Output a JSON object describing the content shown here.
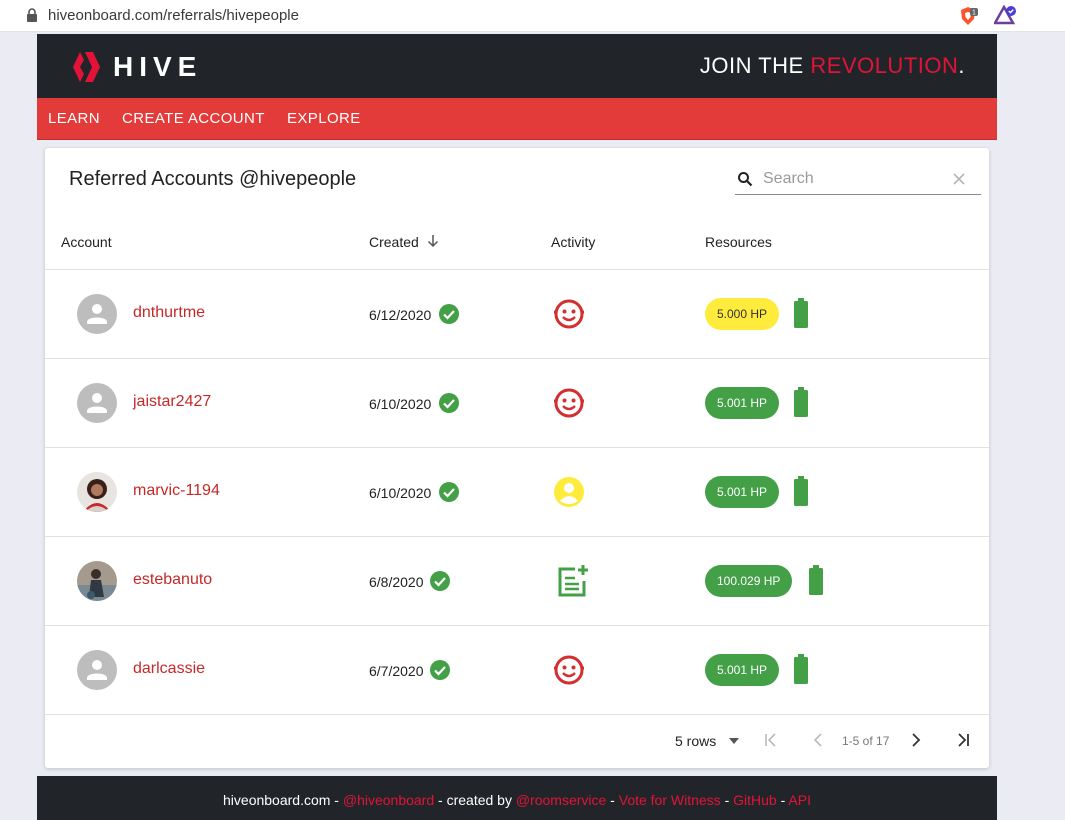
{
  "browser": {
    "url": "hiveonboard.com/referrals/hivepeople",
    "ext_badge": "1"
  },
  "header": {
    "brand": "HIVE",
    "tagline_part1": "JOIN THE ",
    "tagline_part2": "REVOLUTION",
    "tagline_part3": ".",
    "accent_color": "#e31337"
  },
  "nav": {
    "items": [
      "LEARN",
      "CREATE ACCOUNT",
      "EXPLORE"
    ]
  },
  "card": {
    "title": "Referred Accounts @hivepeople",
    "search": {
      "placeholder": "Search",
      "value": ""
    },
    "columns": [
      "Account",
      "Created",
      "Activity",
      "Resources"
    ],
    "sort_column": "Created",
    "sort_direction": "descending",
    "rows": [
      {
        "account": "dnthurtme",
        "avatar": "default-avatar",
        "created": "6/12/2020",
        "verified": true,
        "activity_icon": "baby-face-icon",
        "hp": "5.000 HP",
        "hp_color": "#ffeb3b",
        "battery_level": 1.0
      },
      {
        "account": "jaistar2427",
        "avatar": "default-avatar",
        "created": "6/10/2020",
        "verified": true,
        "activity_icon": "baby-face-icon",
        "hp": "5.001 HP",
        "hp_color": "#43a047",
        "battery_level": 1.0
      },
      {
        "account": "marvic-1194",
        "avatar": "photo-avatar",
        "created": "6/10/2020",
        "verified": true,
        "activity_icon": "face-icon",
        "hp": "5.001 HP",
        "hp_color": "#43a047",
        "battery_level": 1.0
      },
      {
        "account": "estebanuto",
        "avatar": "photo-avatar",
        "created": "6/8/2020",
        "verified": true,
        "activity_icon": "post-add-icon",
        "hp": "100.029 HP",
        "hp_color": "#43a047",
        "battery_level": 1.0
      },
      {
        "account": "darlcassie",
        "avatar": "default-avatar",
        "created": "6/7/2020",
        "verified": true,
        "activity_icon": "baby-face-icon",
        "hp": "5.001 HP",
        "hp_color": "#43a047",
        "battery_level": 1.0
      }
    ],
    "pagination": {
      "rows_per_page": "5 rows",
      "range": "1-5 of 17"
    }
  },
  "footer": {
    "site": "hiveonboard.com - ",
    "handle": "@hiveonboard",
    "created_by": " - created by ",
    "author": "@roomservice",
    "sep1": " - ",
    "vote": "Vote for Witness",
    "sep2": " - ",
    "github": "GitHub",
    "sep3": " - ",
    "api": "API"
  }
}
